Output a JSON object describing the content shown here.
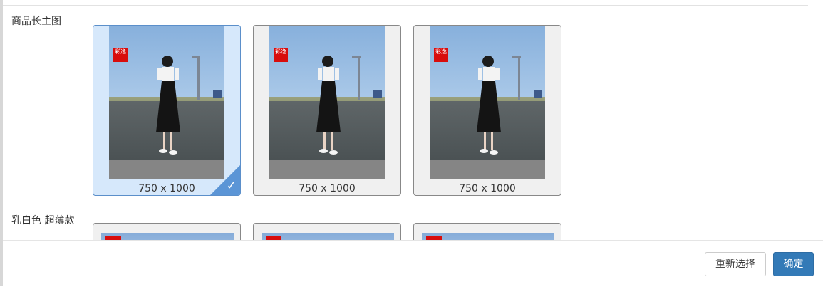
{
  "sections": [
    {
      "label": "商品长主图",
      "images": [
        {
          "dimensions": "750 x 1000",
          "selected": true,
          "logo_text": "彩逸"
        },
        {
          "dimensions": "750 x 1000",
          "selected": false,
          "logo_text": "彩逸"
        },
        {
          "dimensions": "750 x 1000",
          "selected": false,
          "logo_text": "彩逸"
        }
      ]
    },
    {
      "label": "乳白色 超薄款"
    }
  ],
  "footer": {
    "reset_label": "重新选择",
    "confirm_label": "确定"
  },
  "colors": {
    "primary": "#337ab7",
    "selected_bg": "#d6e8fb",
    "selected_corner": "#5b95d6"
  },
  "icons": {
    "selected_check": "checkmark-icon"
  }
}
